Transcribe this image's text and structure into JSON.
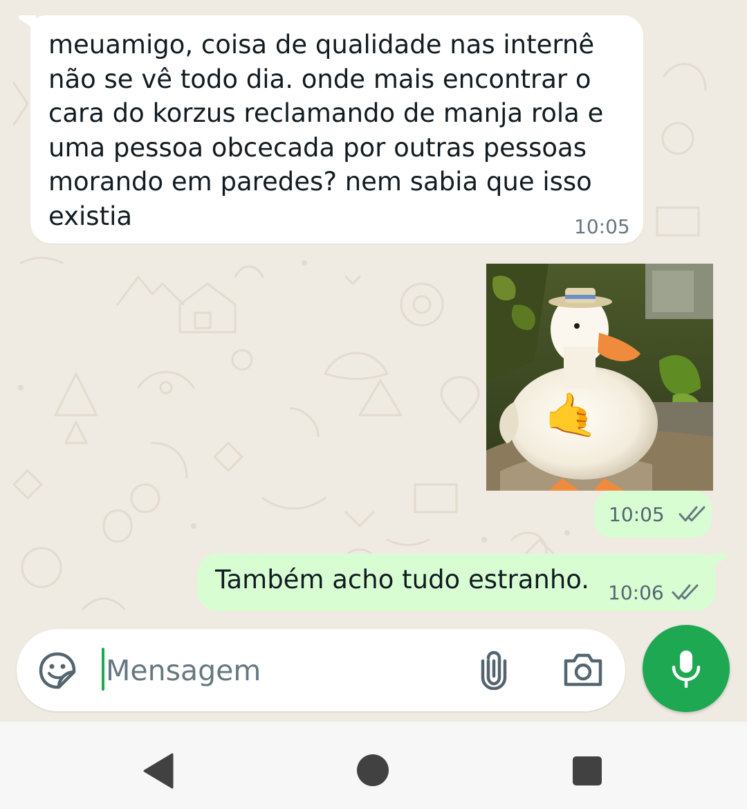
{
  "colors": {
    "incoming_bubble": "#ffffff",
    "outgoing_bubble": "#d9fdd3",
    "chat_background": "#efeae2",
    "accent_green": "#1da851",
    "read_ticks": "#667781"
  },
  "messages": [
    {
      "direction": "incoming",
      "type": "text",
      "lines": [
        "meuamigo, coisa de qualidade nas internê",
        "não se vê todo dia. onde mais encontrar o",
        "cara do korzus reclamando de manja rola e",
        "uma pessoa obcecada por outras pessoas",
        "morando em paredes? nem sabia que isso",
        "existia"
      ],
      "time": "10:05"
    },
    {
      "direction": "outgoing",
      "type": "image",
      "image_description": "white duck wearing a small straw hat, with a call-me hand emoji",
      "emoji": "🤙",
      "time": "10:05",
      "status": "double-check-icon"
    },
    {
      "direction": "outgoing",
      "type": "text",
      "text": "Também acho tudo estranho.",
      "time": "10:06",
      "status": "double-check-icon"
    }
  ],
  "composer": {
    "placeholder": "Mensagem",
    "icons": [
      "sticker-icon",
      "paperclip-icon",
      "camera-icon",
      "microphone-icon"
    ]
  },
  "nav_bar": {
    "icons": [
      "back-triangle-icon",
      "home-circle-icon",
      "recents-square-icon"
    ]
  }
}
